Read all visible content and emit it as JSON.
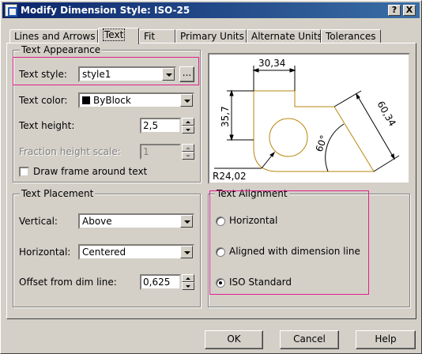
{
  "window": {
    "title": "Modify Dimension Style: ISO-25",
    "help_btn": "?",
    "close_btn": "X"
  },
  "tabs": [
    {
      "label": "Lines and Arrows"
    },
    {
      "label": "Text"
    },
    {
      "label": "Fit"
    },
    {
      "label": "Primary Units"
    },
    {
      "label": "Alternate Units"
    },
    {
      "label": "Tolerances"
    }
  ],
  "text_appearance": {
    "title": "Text Appearance",
    "style_label": "Text style:",
    "style_value": "style1",
    "browse_label": "...",
    "color_label": "Text color:",
    "color_value": "ByBlock",
    "height_label": "Text height:",
    "height_value": "2,5",
    "fraction_label": "Fraction height scale:",
    "fraction_value": "1",
    "frame_label": "Draw frame around text"
  },
  "text_placement": {
    "title": "Text Placement",
    "vertical_label": "Vertical:",
    "vertical_value": "Above",
    "horizontal_label": "Horizontal:",
    "horizontal_value": "Centered",
    "offset_label": "Offset from dim line:",
    "offset_value": "0,625"
  },
  "text_alignment": {
    "title": "Text Alignment",
    "options": [
      {
        "label": "Horizontal",
        "selected": false
      },
      {
        "label": "Aligned with dimension line",
        "selected": false
      },
      {
        "label": "ISO Standard",
        "selected": true
      }
    ]
  },
  "preview": {
    "dim_top": "30,34",
    "dim_left": "35,7",
    "dim_right": "60,34",
    "dim_angle": "60°",
    "dim_radius": "R24,02"
  },
  "buttons": {
    "ok": "OK",
    "cancel": "Cancel",
    "help": "Help"
  },
  "colors": {
    "highlight": "#e0208c",
    "shape": "#b8860b",
    "titlebar": "#0a246a"
  }
}
